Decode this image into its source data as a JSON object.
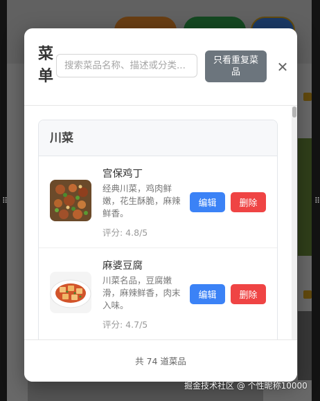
{
  "modal": {
    "title": "菜单",
    "search": {
      "placeholder": "搜索菜品名称、描述或分类...",
      "value": ""
    },
    "dup_button_label": "只看重复菜品",
    "close_label": "✕",
    "category": {
      "name": "川菜",
      "dishes": [
        {
          "name": "宫保鸡丁",
          "description": "经典川菜，鸡肉鲜嫩，花生酥脆，麻辣鲜香。",
          "rating": "评分: 4.8/5",
          "edit_label": "编辑",
          "delete_label": "删除"
        },
        {
          "name": "麻婆豆腐",
          "description": "川菜名品，豆腐嫩滑，麻辣鲜香，肉末入味。",
          "rating": "评分: 4.7/5",
          "edit_label": "编辑",
          "delete_label": "删除"
        }
      ]
    },
    "footer": "共 74 道菜品"
  },
  "watermark": "掘金技术社区 @ 个性昵称10000",
  "colors": {
    "edit": "#3b82f6",
    "delete": "#ef4444",
    "dup_button": "#6c757d"
  }
}
